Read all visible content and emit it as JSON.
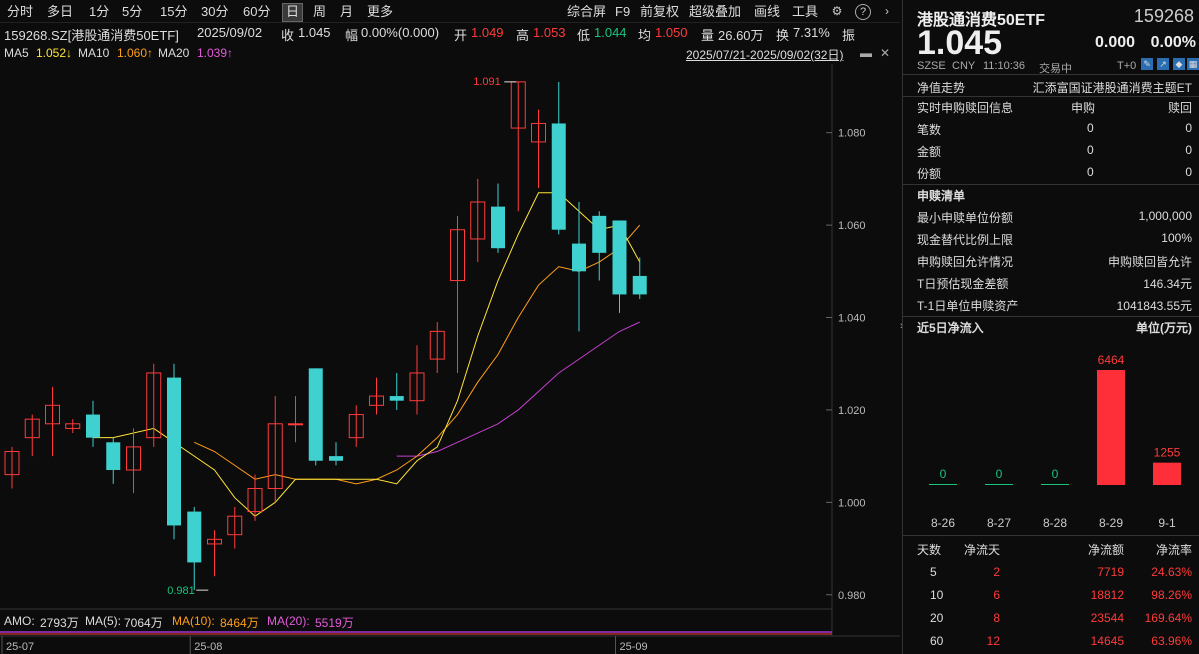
{
  "toolbar": {
    "items": [
      "分时",
      "多日",
      "1分",
      "5分",
      "15分",
      "30分",
      "60分",
      "日",
      "周",
      "月",
      "更多"
    ],
    "active": "日",
    "right_items": [
      "综合屏",
      "F9",
      "前复权",
      "超级叠加",
      "画线",
      "工具"
    ]
  },
  "info": {
    "code_name": "159268.SZ[港股通消费50ETF]",
    "date": "2025/09/02",
    "close_label": "收",
    "close": "1.045",
    "amp_label": "幅",
    "amp": "0.00%(0.000)",
    "open_label": "开",
    "open": "1.049",
    "high_label": "高",
    "high": "1.053",
    "low_label": "低",
    "low": "1.044",
    "avg_label": "均",
    "avg": "1.050",
    "vol_label": "量",
    "vol": "26.60万",
    "turn_label": "换",
    "turn": "7.31%",
    "more_label": "振"
  },
  "ma": {
    "ma5_label": "MA5",
    "ma5": "1.052↓",
    "ma10_label": "MA10",
    "ma10": "1.060↑",
    "ma20_label": "MA20",
    "ma20": "1.039↑",
    "range": "2025/07/21-2025/09/02(32日)"
  },
  "chart_data": {
    "type": "candlestick",
    "ylim": [
      0.978,
      1.094
    ],
    "y_ticks": [
      "1.080",
      "1.060",
      "1.040",
      "1.020",
      "1.000",
      "0.980"
    ],
    "high_annotation": "1.091",
    "low_annotation": "0.981",
    "x_labels": [
      "25-07",
      "25-08",
      "25-09"
    ],
    "candles": [
      {
        "o": 1.006,
        "c": 1.011,
        "h": 1.012,
        "l": 1.003
      },
      {
        "o": 1.014,
        "c": 1.018,
        "h": 1.019,
        "l": 1.01
      },
      {
        "o": 1.017,
        "c": 1.021,
        "h": 1.025,
        "l": 1.01
      },
      {
        "o": 1.016,
        "c": 1.017,
        "h": 1.018,
        "l": 1.015
      },
      {
        "o": 1.019,
        "c": 1.014,
        "h": 1.022,
        "l": 1.012
      },
      {
        "o": 1.013,
        "c": 1.007,
        "h": 1.014,
        "l": 1.004
      },
      {
        "o": 1.007,
        "c": 1.012,
        "h": 1.016,
        "l": 1.002
      },
      {
        "o": 1.014,
        "c": 1.028,
        "h": 1.03,
        "l": 1.012
      },
      {
        "o": 1.027,
        "c": 0.995,
        "h": 1.03,
        "l": 0.992
      },
      {
        "o": 0.998,
        "c": 0.987,
        "h": 0.999,
        "l": 0.981
      },
      {
        "o": 0.991,
        "c": 0.992,
        "h": 0.994,
        "l": 0.984
      },
      {
        "o": 0.993,
        "c": 0.997,
        "h": 0.999,
        "l": 0.99
      },
      {
        "o": 0.998,
        "c": 1.003,
        "h": 1.006,
        "l": 0.996
      },
      {
        "o": 1.003,
        "c": 1.017,
        "h": 1.023,
        "l": 1.0
      },
      {
        "o": 1.017,
        "c": 1.017,
        "h": 1.023,
        "l": 1.013
      },
      {
        "o": 1.029,
        "c": 1.009,
        "h": 1.029,
        "l": 1.008
      },
      {
        "o": 1.01,
        "c": 1.009,
        "h": 1.013,
        "l": 1.008
      },
      {
        "o": 1.014,
        "c": 1.019,
        "h": 1.021,
        "l": 1.012
      },
      {
        "o": 1.021,
        "c": 1.023,
        "h": 1.027,
        "l": 1.019
      },
      {
        "o": 1.023,
        "c": 1.022,
        "h": 1.028,
        "l": 1.02
      },
      {
        "o": 1.022,
        "c": 1.028,
        "h": 1.034,
        "l": 1.019
      },
      {
        "o": 1.031,
        "c": 1.037,
        "h": 1.039,
        "l": 1.028
      },
      {
        "o": 1.048,
        "c": 1.059,
        "h": 1.062,
        "l": 1.028
      },
      {
        "o": 1.057,
        "c": 1.065,
        "h": 1.07,
        "l": 1.052
      },
      {
        "o": 1.064,
        "c": 1.055,
        "h": 1.069,
        "l": 1.054
      },
      {
        "o": 1.081,
        "c": 1.091,
        "h": 1.091,
        "l": 1.063
      },
      {
        "o": 1.078,
        "c": 1.082,
        "h": 1.085,
        "l": 1.068
      },
      {
        "o": 1.082,
        "c": 1.059,
        "h": 1.091,
        "l": 1.058
      },
      {
        "o": 1.056,
        "c": 1.05,
        "h": 1.065,
        "l": 1.037
      },
      {
        "o": 1.062,
        "c": 1.054,
        "h": 1.063,
        "l": 1.048
      },
      {
        "o": 1.061,
        "c": 1.045,
        "h": 1.061,
        "l": 1.041
      },
      {
        "o": 1.049,
        "c": 1.045,
        "h": 1.053,
        "l": 1.044
      }
    ],
    "ma5": [
      null,
      null,
      null,
      null,
      1.014,
      1.014,
      1.015,
      1.016,
      1.013,
      1.01,
      1.007,
      1.001,
      0.997,
      1.0,
      1.005,
      1.005,
      1.005,
      1.005,
      1.005,
      1.004,
      1.009,
      1.012,
      1.022,
      1.036,
      1.048,
      1.058,
      1.067,
      1.067,
      1.063,
      1.059,
      1.06,
      1.052
    ],
    "ma10": [
      null,
      null,
      null,
      null,
      null,
      null,
      null,
      null,
      null,
      1.013,
      1.011,
      1.008,
      1.005,
      1.006,
      1.005,
      1.005,
      1.005,
      1.004,
      1.005,
      1.007,
      1.01,
      1.014,
      1.019,
      1.026,
      1.032,
      1.04,
      1.047,
      1.051,
      1.05,
      1.052,
      1.055,
      1.06
    ],
    "ma20": [
      null,
      null,
      null,
      null,
      null,
      null,
      null,
      null,
      null,
      null,
      null,
      null,
      null,
      null,
      null,
      null,
      null,
      null,
      null,
      1.01,
      1.01,
      1.011,
      1.013,
      1.015,
      1.017,
      1.02,
      1.024,
      1.028,
      1.031,
      1.034,
      1.037,
      1.039
    ]
  },
  "volume_legend": {
    "amo_label": "AMO:",
    "amo": "2793万",
    "ma5_label": "MA(5):",
    "ma5": "7064万",
    "ma10_label": "MA(10):",
    "ma10": "8464万",
    "ma20_label": "MA(20):",
    "ma20": "5519万"
  },
  "right": {
    "title": "港股通消费50ETF",
    "code": "159268",
    "price": "1.045",
    "change": "0.000",
    "change_pct": "0.00%",
    "market": "SZSE",
    "currency": "CNY",
    "time": "11:10:36",
    "status": "交易中",
    "t0": "T+0",
    "nav_label": "净值走势",
    "fund_name": "汇添富国证港股通消费主题ET",
    "realtime_title": "实时申购赎回信息",
    "sub_col": "申购",
    "red_col": "赎回",
    "realtime_rows": [
      {
        "label": "笔数",
        "sub": "0",
        "red": "0"
      },
      {
        "label": "金额",
        "sub": "0",
        "red": "0"
      },
      {
        "label": "份额",
        "sub": "0",
        "red": "0"
      }
    ],
    "list_title": "申赎清单",
    "list_rows": [
      {
        "label": "最小申赎单位份额",
        "value": "1,000,000"
      },
      {
        "label": "现金替代比例上限",
        "value": "100%"
      },
      {
        "label": "申购赎回允许情况",
        "value": "申购赎回皆允许"
      },
      {
        "label": "T日预估现金差额",
        "value": "146.34元"
      },
      {
        "label": "T-1日单位申赎资产",
        "value": "1041843.55元"
      }
    ],
    "flow_title": "近5日净流入",
    "flow_unit": "单位(万元)",
    "flow_bars": [
      {
        "date": "8-26",
        "value": 0
      },
      {
        "date": "8-27",
        "value": 0
      },
      {
        "date": "8-28",
        "value": 0
      },
      {
        "date": "8-29",
        "value": 6464
      },
      {
        "date": "9-1",
        "value": 1255
      }
    ],
    "flow_labels": [
      "0",
      "0",
      "0",
      "6464",
      "1255"
    ],
    "stats_headers": [
      "天数",
      "净流天",
      "净流额",
      "净流率"
    ],
    "stats_rows": [
      {
        "days": "5",
        "net_days": "2",
        "amount": "7719",
        "rate": "24.63%"
      },
      {
        "days": "10",
        "net_days": "6",
        "amount": "18812",
        "rate": "98.26%"
      },
      {
        "days": "20",
        "net_days": "8",
        "amount": "23544",
        "rate": "169.64%"
      },
      {
        "days": "60",
        "net_days": "12",
        "amount": "14645",
        "rate": "63.96%"
      }
    ]
  },
  "colors": {
    "up": "#ff3b3b",
    "down": "#3fd0d0",
    "ma5": "#ffe438",
    "ma10": "#ff9f1a",
    "ma20": "#c63fd0"
  }
}
